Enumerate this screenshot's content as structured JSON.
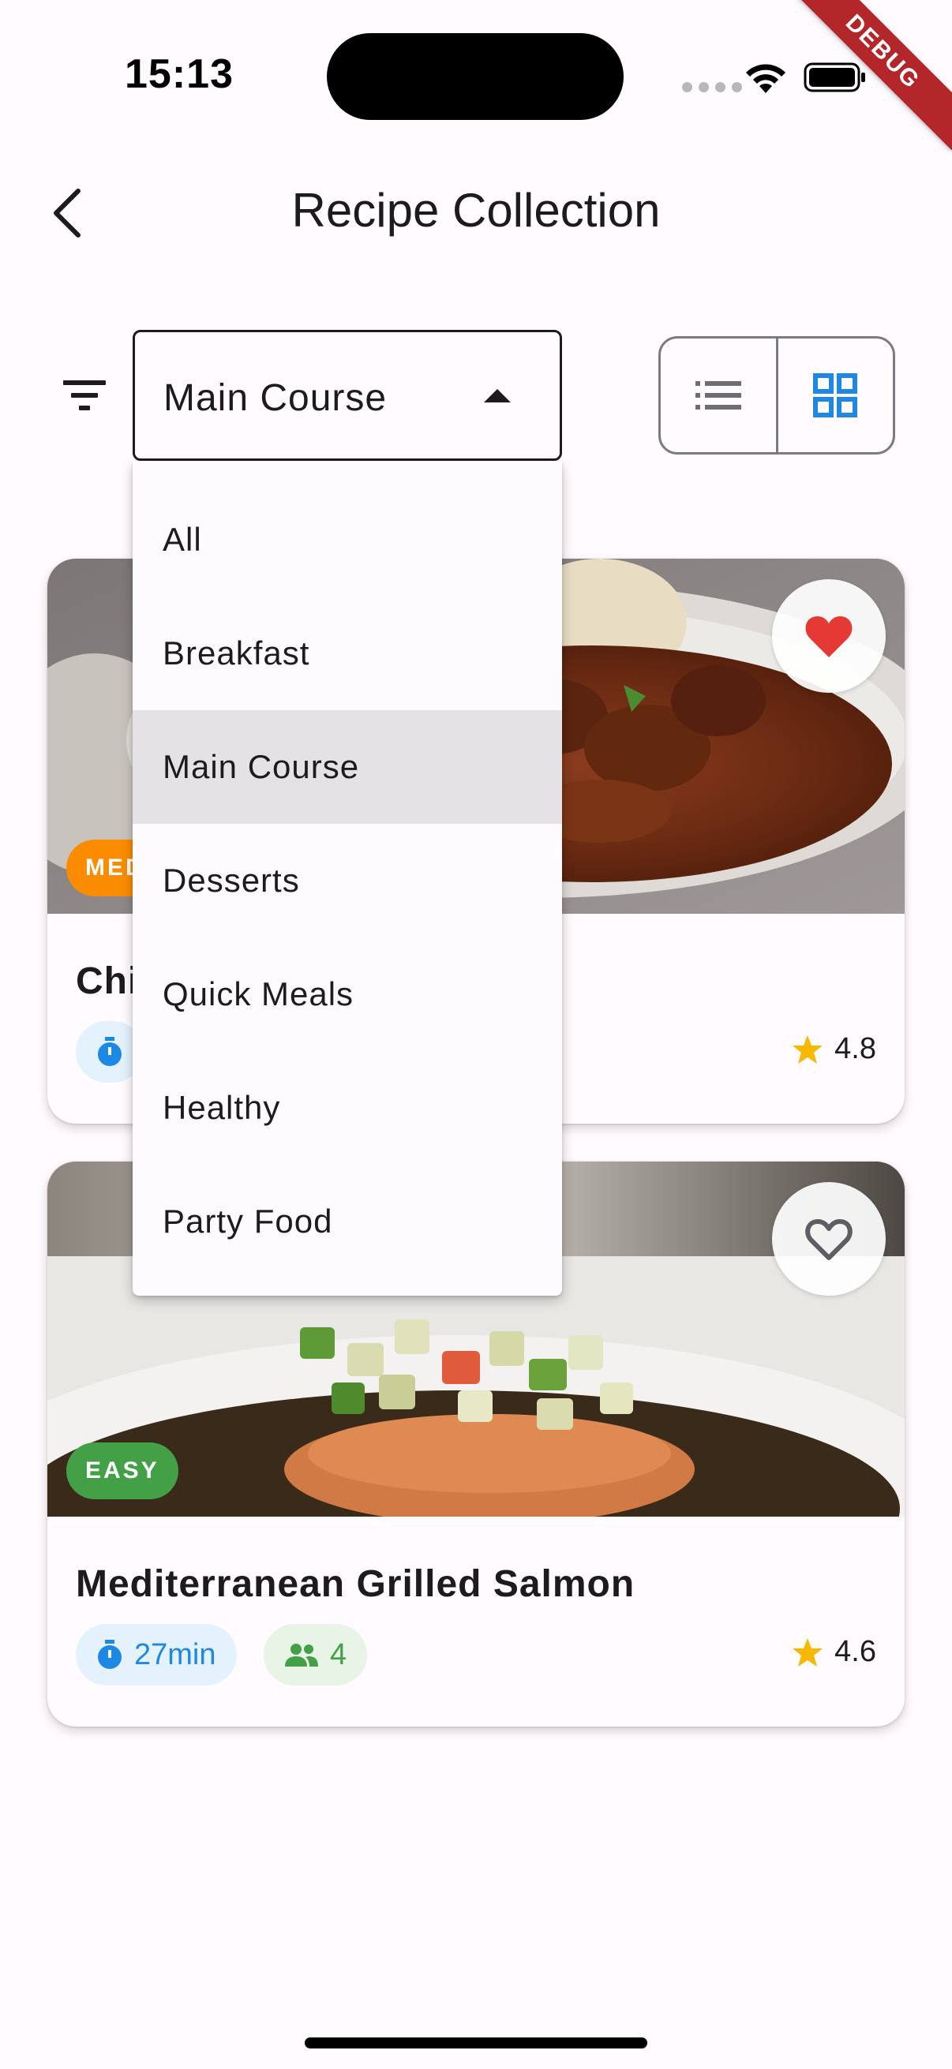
{
  "status_bar": {
    "time": "15:13",
    "debug_label": "DEBUG"
  },
  "app_bar": {
    "title": "Recipe Collection"
  },
  "filter": {
    "selected_category": "Main Course",
    "options": [
      "All",
      "Breakfast",
      "Main Course",
      "Desserts",
      "Quick Meals",
      "Healthy",
      "Party Food"
    ],
    "selected_index": 2
  },
  "view_toggle": {
    "selected": "grid"
  },
  "recipes": [
    {
      "title": "Chi",
      "difficulty": "MED",
      "difficulty_color": "#fb8c00",
      "time": "",
      "servings": "",
      "rating": "4.8",
      "favorite": true
    },
    {
      "title": "Mediterranean Grilled Salmon",
      "difficulty": "EASY",
      "difficulty_color": "#43a047",
      "time": "27min",
      "servings": "4",
      "rating": "4.6",
      "favorite": false
    }
  ],
  "colors": {
    "accent": "#1e88e5",
    "favorite": "#e53935",
    "star": "#f9b800"
  }
}
